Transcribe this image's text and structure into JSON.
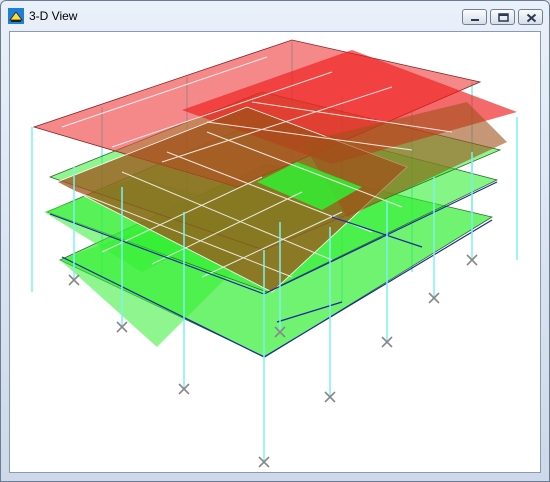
{
  "window": {
    "title": "3-D View",
    "app_icon": "structure-app-icon",
    "controls": {
      "minimize": "minimize-icon",
      "maximize": "maximize-icon",
      "close": "close-icon"
    }
  },
  "view": {
    "type": "3d-structural-model",
    "colors": {
      "roof_slab": "#ee3a3a",
      "floor_slab": "#33ee33",
      "column": "#7ff0f0",
      "beam": "#1a2a9a",
      "support": "#888888"
    }
  }
}
